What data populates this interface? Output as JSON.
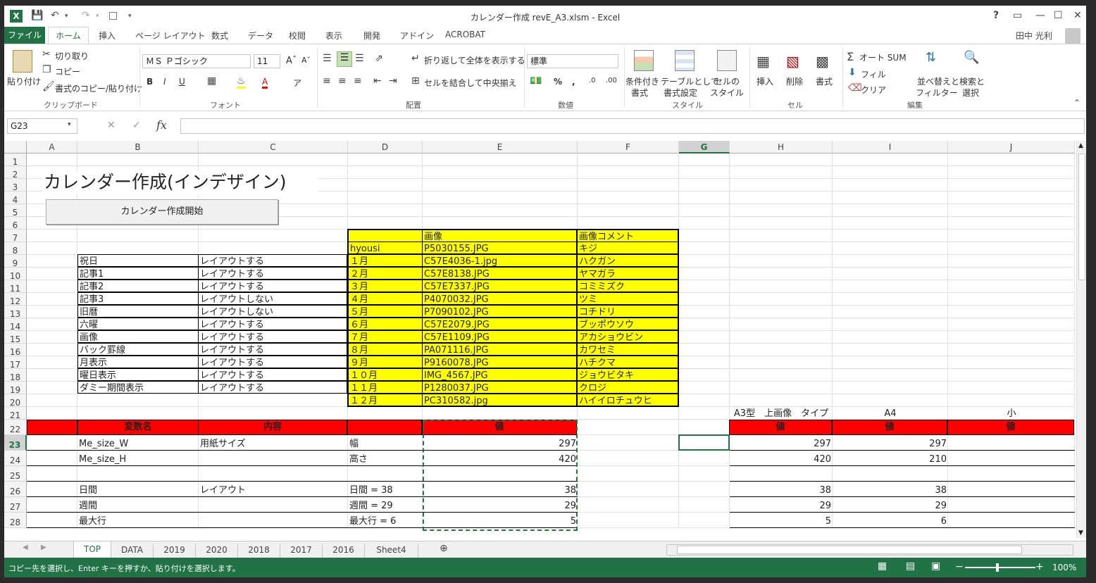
{
  "window": {
    "title": "カレンダー作成 revE_A3.xlsm - Excel",
    "user": "田中 光利",
    "help": "?"
  },
  "ribbon_tabs": [
    "ファイル",
    "ホーム",
    "挿入",
    "ページ レイアウト",
    "数式",
    "データ",
    "校閲",
    "表示",
    "開発",
    "アドイン",
    "ACROBAT"
  ],
  "ribbon": {
    "clipboard": {
      "paste": "貼り付け",
      "cut": "切り取り",
      "copy": "コピー",
      "format_painter": "書式のコピー/貼り付け",
      "label": "クリップボード"
    },
    "font": {
      "name": "ＭＳ Ｐゴシック",
      "size": "11",
      "label": "フォント"
    },
    "alignment": {
      "wrap": "折り返して全体を表示する",
      "merge": "セルを結合して中央揃え",
      "label": "配置"
    },
    "number": {
      "format": "標準",
      "label": "数値"
    },
    "styles": {
      "cond": "条件付き",
      "cond2": "書式",
      "table": "テーブルとして",
      "table2": "書式設定",
      "cell": "セルの",
      "cell2": "スタイル",
      "label": "スタイル"
    },
    "cells": {
      "insert": "挿入",
      "delete": "削除",
      "format": "書式",
      "label": "セル"
    },
    "editing": {
      "autosum": "オート SUM",
      "fill": "フィル",
      "clear": "クリア",
      "sort": "並べ替えと",
      "sort2": "フィルター",
      "find": "検索と",
      "find2": "選択",
      "label": "編集"
    }
  },
  "formula_bar": {
    "name_box": "G23",
    "formula": ""
  },
  "columns": [
    "A",
    "B",
    "C",
    "D",
    "E",
    "F",
    "G",
    "H",
    "I",
    "J"
  ],
  "rows": [
    "1",
    "2",
    "3",
    "4",
    "5",
    "6",
    "7",
    "8",
    "9",
    "10",
    "11",
    "12",
    "13",
    "14",
    "15",
    "16",
    "17",
    "18",
    "19",
    "20",
    "21",
    "22",
    "23",
    "24",
    "25",
    "26",
    "27",
    "28"
  ],
  "sheet": {
    "title": "カレンダー作成(インデザイン)",
    "start_button": "カレンダー作成開始",
    "options": [
      [
        "祝日",
        "レイアウトする"
      ],
      [
        "記事1",
        "レイアウトする"
      ],
      [
        "記事2",
        "レイアウトする"
      ],
      [
        "記事3",
        "レイアウトしない"
      ],
      [
        "旧暦",
        "レイアウトしない"
      ],
      [
        "六曜",
        "レイアウトする"
      ],
      [
        "画像",
        "レイアウトする"
      ],
      [
        "バック罫線",
        "レイアウトする"
      ],
      [
        "月表示",
        "レイアウトする"
      ],
      [
        "曜日表示",
        "レイアウトする"
      ],
      [
        "ダミー期間表示",
        "レイアウトする"
      ]
    ],
    "image_table_header": [
      "",
      "画像",
      "画像コメント"
    ],
    "image_table": [
      [
        "hyousi",
        "P5030155.JPG",
        "キジ"
      ],
      [
        "１月",
        "C57E4036-1.jpg",
        "ハクガン"
      ],
      [
        "２月",
        "C57E8138.JPG",
        "ヤマガラ"
      ],
      [
        "３月",
        "C57E7337.JPG",
        "コミミズク"
      ],
      [
        "４月",
        "P4070032.JPG",
        "ツミ"
      ],
      [
        "５月",
        "P7090102.JPG",
        "コチドリ"
      ],
      [
        "６月",
        "C57E2079.JPG",
        "ブッポウソウ"
      ],
      [
        "７月",
        "C57E1109.JPG",
        "アカショウビン"
      ],
      [
        "８月",
        "PA071116.JPG",
        "カワセミ"
      ],
      [
        "９月",
        "P9160078.JPG",
        "ハチクマ"
      ],
      [
        "１０月",
        "IMG_4567.JPG",
        "ジョウビタキ"
      ],
      [
        "１１月",
        "P1280037.JPG",
        "クロジ"
      ],
      [
        "１２月",
        "PC310582.jpg",
        "ハイイロチュウヒ"
      ]
    ],
    "h21": "A3型　上画像　タイプ",
    "i21": "A4",
    "j21": "小",
    "var_header": [
      "変数名",
      "内容",
      "",
      "値"
    ],
    "value_header": [
      "値",
      "値",
      "値"
    ],
    "var_rows": [
      [
        "Me_size_W",
        "用紙サイズ",
        "幅",
        "297",
        "297",
        "297",
        ""
      ],
      [
        "Me_size_H",
        "",
        "高さ",
        "420",
        "420",
        "210",
        ""
      ],
      [
        "",
        "",
        "",
        "",
        "",
        "",
        ""
      ],
      [
        "日間",
        "レイアウト",
        "日間 = 38",
        "38",
        "38",
        "38",
        ""
      ],
      [
        "週間",
        "",
        "週間 = 29",
        "29",
        "29",
        "29",
        ""
      ],
      [
        "最大行",
        "",
        "最大行 = 6",
        "5",
        "5",
        "6",
        ""
      ]
    ]
  },
  "sheet_tabs": [
    "TOP",
    "DATA",
    "2019",
    "2020",
    "2018",
    "2017",
    "2016",
    "Sheet4"
  ],
  "status": {
    "message": "コピー先を選択し、Enter キーを押すか、貼り付けを選択します。",
    "zoom": "100%"
  },
  "colors": {
    "excel_green": "#217346",
    "highlight_yellow": "#ffff00",
    "header_red": "#ff0000"
  }
}
